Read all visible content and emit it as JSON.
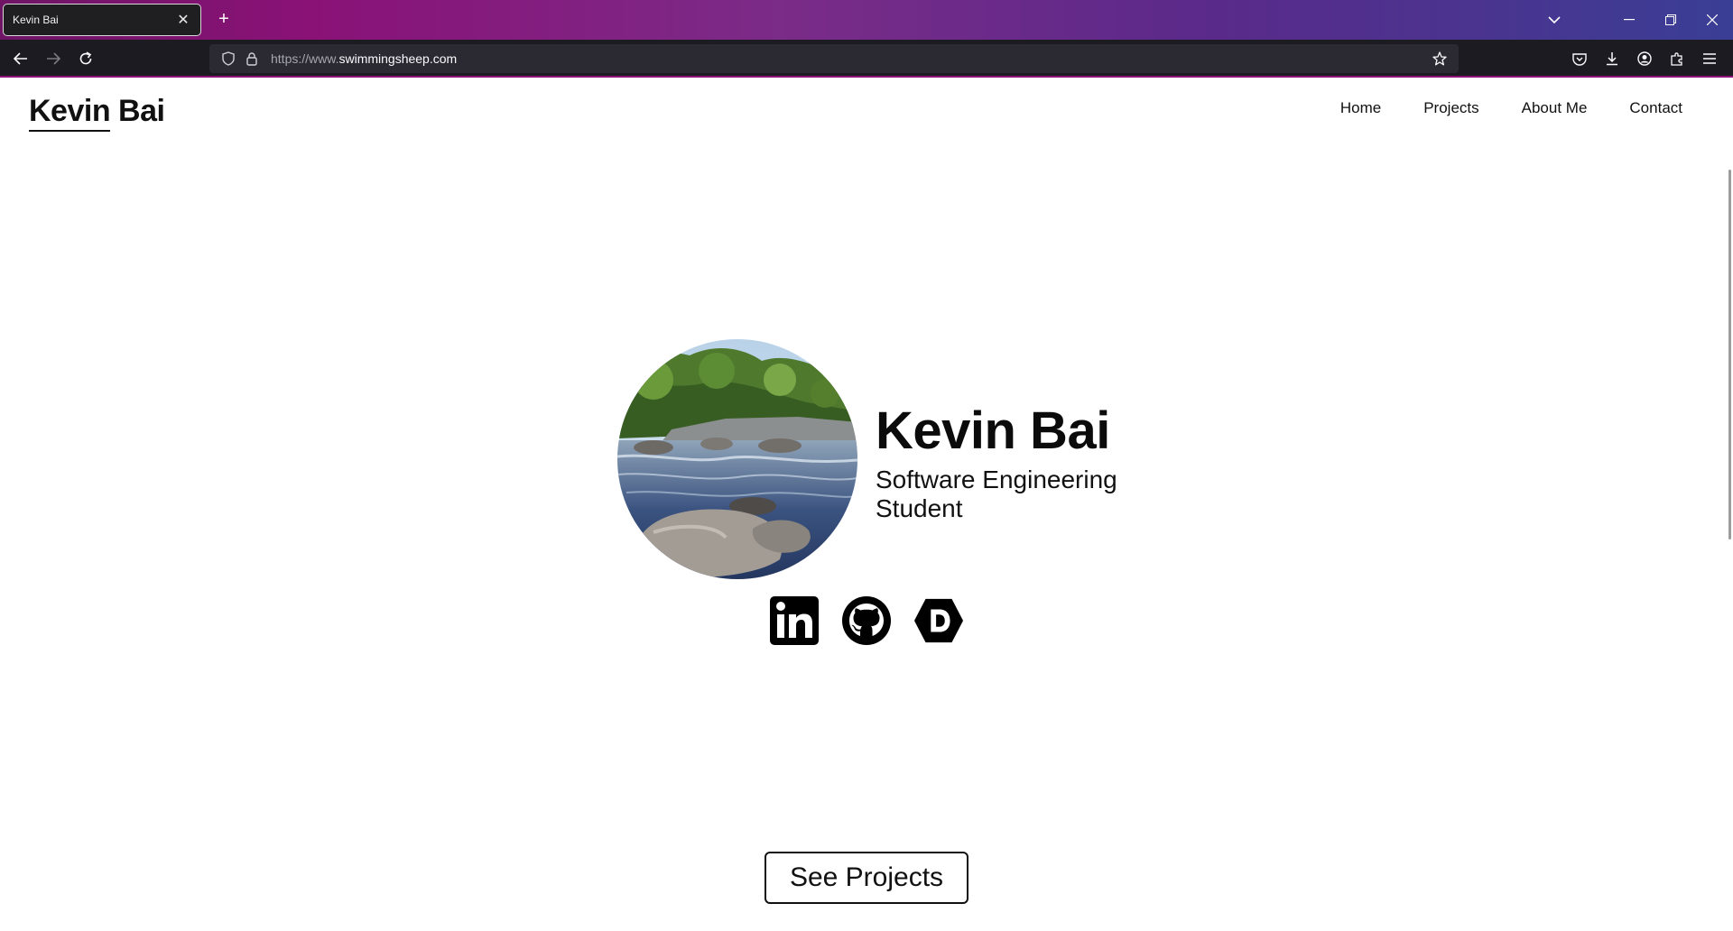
{
  "browser": {
    "tab_title": "Kevin Bai",
    "url_prefix": "https://www.",
    "url_domain": "swimmingsheep.com",
    "accent": "#8a1277"
  },
  "header": {
    "logo": "Kevin Bai",
    "nav": [
      "Home",
      "Projects",
      "About Me",
      "Contact"
    ]
  },
  "hero": {
    "name": "Kevin Bai",
    "title": "Software Engineering Student",
    "avatar_desc": "river-rocks-photo"
  },
  "socials": [
    {
      "icon": "linkedin-icon"
    },
    {
      "icon": "github-icon"
    },
    {
      "icon": "devpost-icon"
    }
  ],
  "cta": {
    "label": "See Projects"
  }
}
